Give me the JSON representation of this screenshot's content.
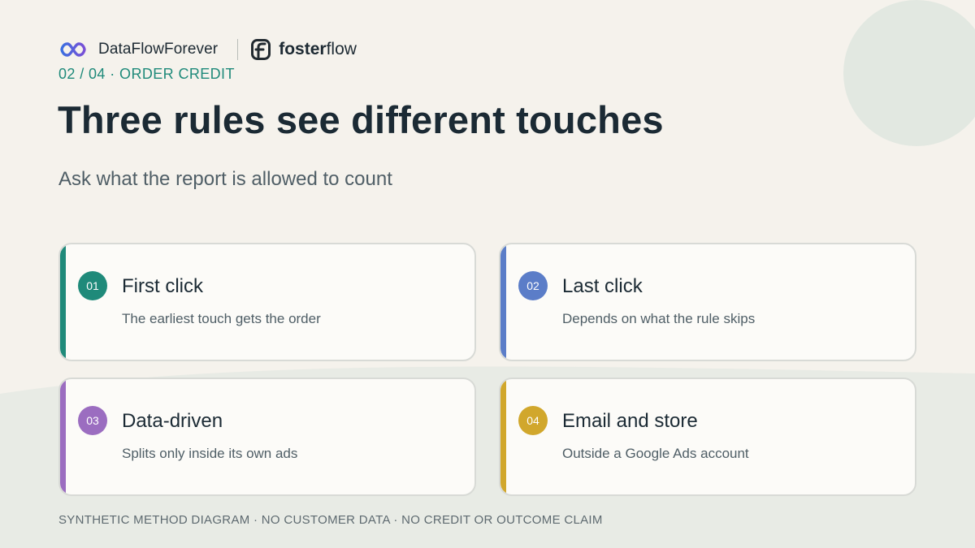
{
  "brand": {
    "name": "DataFlowForever",
    "partner_prefix": "foster",
    "partner_suffix": "flow"
  },
  "kicker": "02 / 04 · ORDER CREDIT",
  "title": "Three rules see different touches",
  "subtitle": "Ask what the report is allowed to count",
  "cards": [
    {
      "number": "01",
      "title": "First click",
      "description": "The earliest touch gets the order",
      "accent": "#1f8a7a"
    },
    {
      "number": "02",
      "title": "Last click",
      "description": "Depends on what the rule skips",
      "accent": "#5b7dc8"
    },
    {
      "number": "03",
      "title": "Data-driven",
      "description": "Splits only inside its own ads",
      "accent": "#9b6dc0"
    },
    {
      "number": "04",
      "title": "Email and store",
      "description": "Outside a Google Ads account",
      "accent": "#d1a72c"
    }
  ],
  "footer": "SYNTHETIC METHOD DIAGRAM · NO CUSTOMER DATA · NO CREDIT OR OUTCOME CLAIM",
  "icons": {
    "brand_logo": "infinity-loop-icon",
    "partner_logo": "fosterflow-f-icon"
  },
  "colors": {
    "background": "#f5f2ec",
    "kicker": "#1f8a7a",
    "title": "#1b2a34"
  }
}
